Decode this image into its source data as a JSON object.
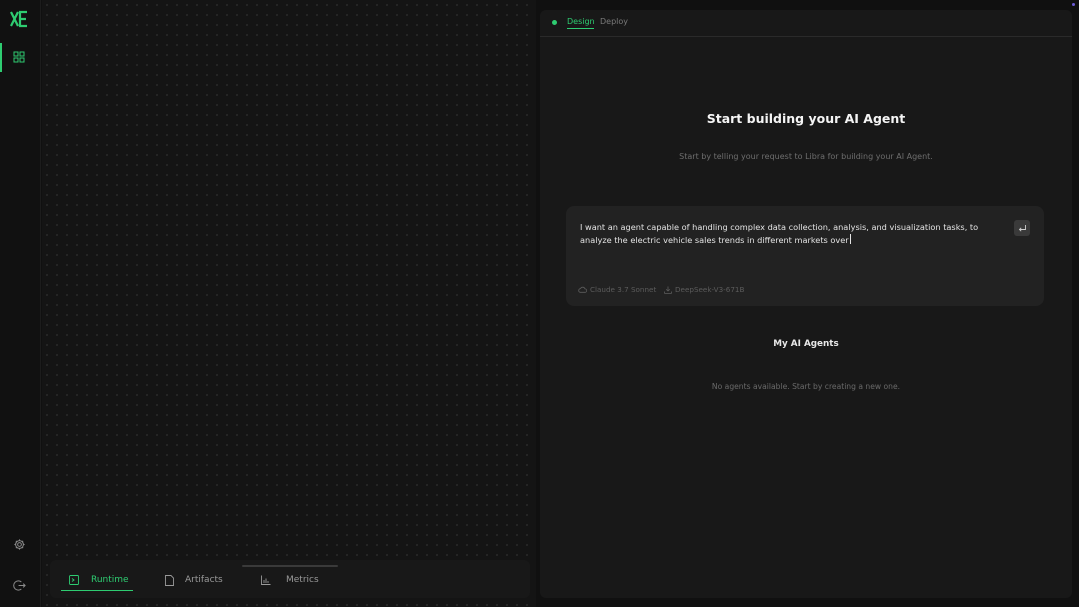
{
  "sidebar": {
    "logo": {
      "icon": "xe-logo-icon",
      "color": "#2ecc71"
    },
    "items": [
      {
        "icon": "grid-icon",
        "active": true
      },
      {
        "icon": "gear-icon",
        "active": false
      },
      {
        "icon": "logout-icon",
        "active": false
      }
    ]
  },
  "runtime_panel": {
    "tabs": [
      {
        "label": "Runtime",
        "icon": "terminal-icon",
        "active": true
      },
      {
        "label": "Artifacts",
        "icon": "file-icon",
        "active": false
      },
      {
        "label": "Metrics",
        "icon": "bar-chart-icon",
        "active": false
      }
    ]
  },
  "builder": {
    "tabs": [
      {
        "label": "Design",
        "active": true
      },
      {
        "label": "Deploy",
        "active": false
      }
    ],
    "status_color": "#2ecc71",
    "title": "Start building your AI Agent",
    "subtitle": "Start by telling your request to Libra for building your AI Agent.",
    "prompt": {
      "value": "I want an agent capable of handling complex data collection, analysis, and visualization tasks, to analyze the electric vehicle sales trends in different markets over",
      "send_icon": "enter-icon",
      "models": [
        {
          "label": "Claude 3.7 Sonnet",
          "icon": "cloud-icon"
        },
        {
          "label": "DeepSeek-V3-671B",
          "icon": "download-icon"
        }
      ]
    },
    "agents_section": {
      "title": "My AI Agents",
      "empty_text": "No agents available. Start by creating a new one."
    }
  },
  "colors": {
    "accent": "#2ecc71",
    "background": "#101010",
    "panel": "#181818",
    "input": "#222222"
  }
}
